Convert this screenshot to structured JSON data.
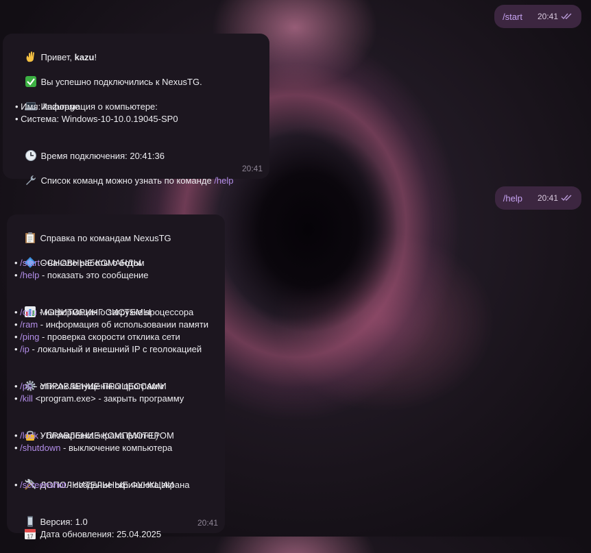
{
  "out_messages": [
    {
      "text": "/start",
      "time": "20:41"
    },
    {
      "text": "/help",
      "time": "20:41"
    }
  ],
  "msg1": {
    "greeting_prefix": "Привет, ",
    "greeting_name": "kazu",
    "greeting_suffix": "!",
    "connected": "Вы успешно подключились к NexusTG.",
    "pc_info_title": "Информация о компьютере:",
    "pc_name": "• Имя: kazurage",
    "pc_system": "• Система: Windows-10-10.0.19045-SP0",
    "conn_time": "Время подключения: 20:41:36",
    "commands_hint": "Список команд можно узнать по команде ",
    "commands_hint_cmd": "/help",
    "time": "20:41"
  },
  "msg2": {
    "title": "Справка по командам NexusTG",
    "sections": [
      {
        "icon": "blue-diamond-icon",
        "title": "ОСНОВНЫЕ КОМАНДЫ",
        "items": [
          {
            "cmd": "/start",
            "desc": " - начало работы с ботом"
          },
          {
            "cmd": "/help",
            "desc": " - показать это сообщение"
          }
        ]
      },
      {
        "icon": "bar-chart-icon",
        "title": "МОНИТОРИНГ СИСТЕМЫ",
        "items": [
          {
            "cmd": "/cpu",
            "desc": " - информация о загрузке процессора"
          },
          {
            "cmd": "/ram",
            "desc": " - информация об использовании памяти"
          },
          {
            "cmd": "/ping",
            "desc": " - проверка скорости отклика сети"
          },
          {
            "cmd": "/ip",
            "desc": " - локальный и внешний IP с геолокацией"
          }
        ]
      },
      {
        "icon": "gear-icon",
        "title": "УПРАВЛЕНИЕ ПРОЦЕССАМИ",
        "items": [
          {
            "cmd": "/ps",
            "desc": " - список запущенных программ"
          },
          {
            "cmd": "/kill",
            "desc": " <program.exe> - закрыть программу"
          }
        ]
      },
      {
        "icon": "lock-icon",
        "title": "УПРАВЛЕНИЕ КОМПЬЮТЕРОМ",
        "items": [
          {
            "cmd": "/lock",
            "desc": " - блокировка экрана (Win+L)"
          },
          {
            "cmd": "/shutdown",
            "desc": " - выключение компьютера"
          }
        ]
      },
      {
        "icon": "tools-icon",
        "title": "ДОПОЛНИТЕЛЬНЫЕ ФУНКЦИИ",
        "items": [
          {
            "cmd": "/screenshot",
            "desc": " - создание скриншота экрана"
          }
        ]
      }
    ],
    "version": "Версия: 1.0",
    "updated": "Дата обновления: 25.04.2025",
    "time": "20:41"
  },
  "colors": {
    "accent": "#b38ee9",
    "outgoing_bubble": "#3c2640",
    "incoming_bubble": "#1c161f"
  }
}
